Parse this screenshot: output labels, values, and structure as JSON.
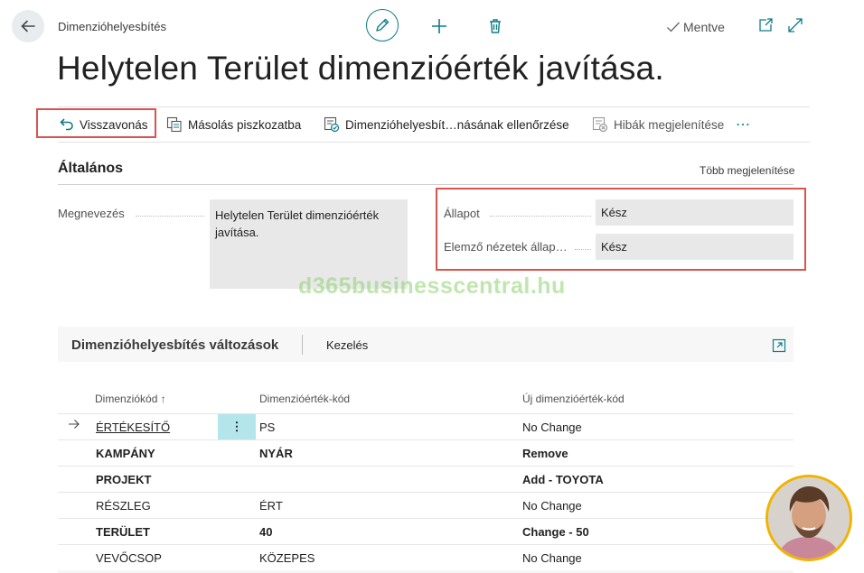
{
  "breadcrumb": "Dimenzióhelyesbítés",
  "saved_label": "Mentve",
  "title": "Helytelen Terület dimenzióérték javítása.",
  "actions": [
    {
      "label": "Visszavonás",
      "icon": "undo-icon"
    },
    {
      "label": "Másolás piszkozatba",
      "icon": "copy-draft-icon"
    },
    {
      "label": "Dimenzióhelyesbít…násának ellenőrzése",
      "icon": "validate-icon"
    },
    {
      "label": "Hibák megjelenítése",
      "icon": "show-errors-icon"
    }
  ],
  "more_actions": "⋯",
  "general": {
    "title": "Általános",
    "show_more": "Több megjelenítése",
    "description_label": "Megnevezés",
    "description_value": "Helytelen Terület dimenzióérték javítása.",
    "status_label": "Állapot",
    "status_value": "Kész",
    "analysis_label": "Elemző nézetek állap…",
    "analysis_value": "Kész"
  },
  "changes": {
    "title": "Dimenzióhelyesbítés változások",
    "manage": "Kezelés",
    "columns": [
      "Dimenziókód ↑",
      "Dimenzióérték-kód",
      "Új dimenzióérték-kód"
    ],
    "rows": [
      {
        "code": "ÉRTÉKESÍTŐ",
        "value": "PS",
        "new": "No Change",
        "bold": false,
        "selected": true
      },
      {
        "code": "KAMPÁNY",
        "value": "NYÁR",
        "new": "Remove",
        "bold": true
      },
      {
        "code": "PROJEKT",
        "value": "",
        "new": "Add - TOYOTA",
        "bold": true
      },
      {
        "code": "RÉSZLEG",
        "value": "ÉRT",
        "new": "No Change",
        "bold": false
      },
      {
        "code": "TERÜLET",
        "value": "40",
        "new": "Change - 50",
        "bold": true
      },
      {
        "code": "VEVŐCSOP",
        "value": "KÖZEPES",
        "new": "No Change",
        "bold": false
      }
    ]
  },
  "watermark": "d365businesscentral.hu",
  "colors": {
    "accent": "#0e7c86",
    "highlight": "#d9534f",
    "selected_cell": "#b3e5ea",
    "avatar_ring": "#f0b400"
  }
}
